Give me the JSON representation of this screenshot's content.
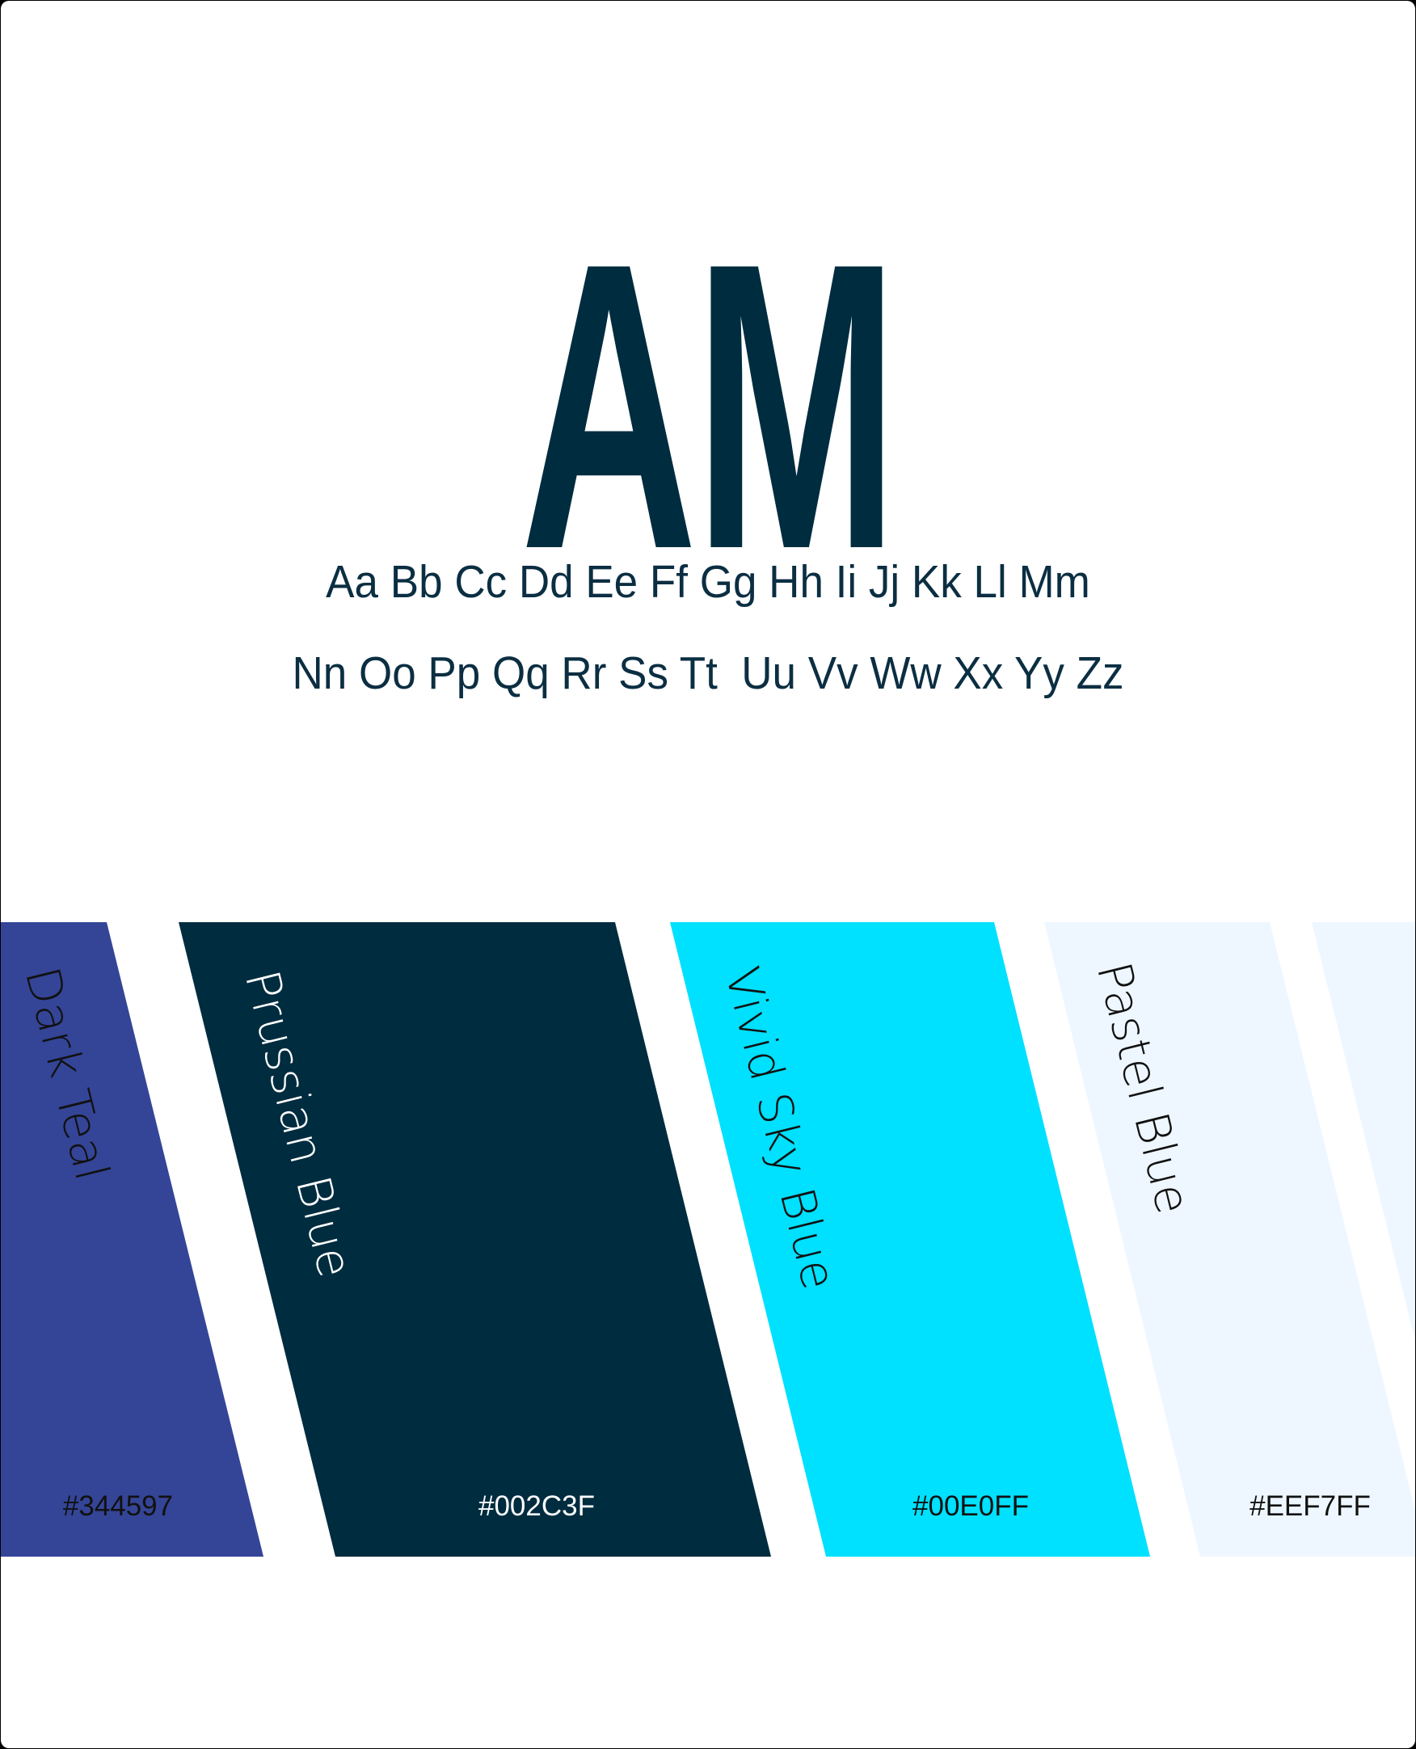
{
  "logo": {
    "text": "AM",
    "color": "#002C3F"
  },
  "alphabet": {
    "line1": "Aa Bb Cc Dd Ee Ff Gg Hh Ii Jj Kk Ll Mm",
    "line2": "Nn Oo Pp Qq Rr Ss Tt  Uu Vv Ww Xx Yy Zz",
    "color": "#0B2E42"
  },
  "palette": [
    {
      "name": "Dark Teal",
      "hex_label": "#344597",
      "color": "#344597",
      "text_color": "#111111"
    },
    {
      "name": "Prussian Blue",
      "hex_label": "#002C3F",
      "color": "#002C3F",
      "text_color": "#ffffff"
    },
    {
      "name": "Vivid Sky Blue",
      "hex_label": "#00E0FF",
      "color": "#00E0FF",
      "text_color": "#111111"
    },
    {
      "name": "Pastel Blue",
      "hex_label": "#EEF7FF",
      "color": "#EEF7FF",
      "text_color": "#111111"
    },
    {
      "name": "",
      "hex_label": "",
      "color": "#EEF7FF",
      "text_color": "#111111"
    }
  ]
}
